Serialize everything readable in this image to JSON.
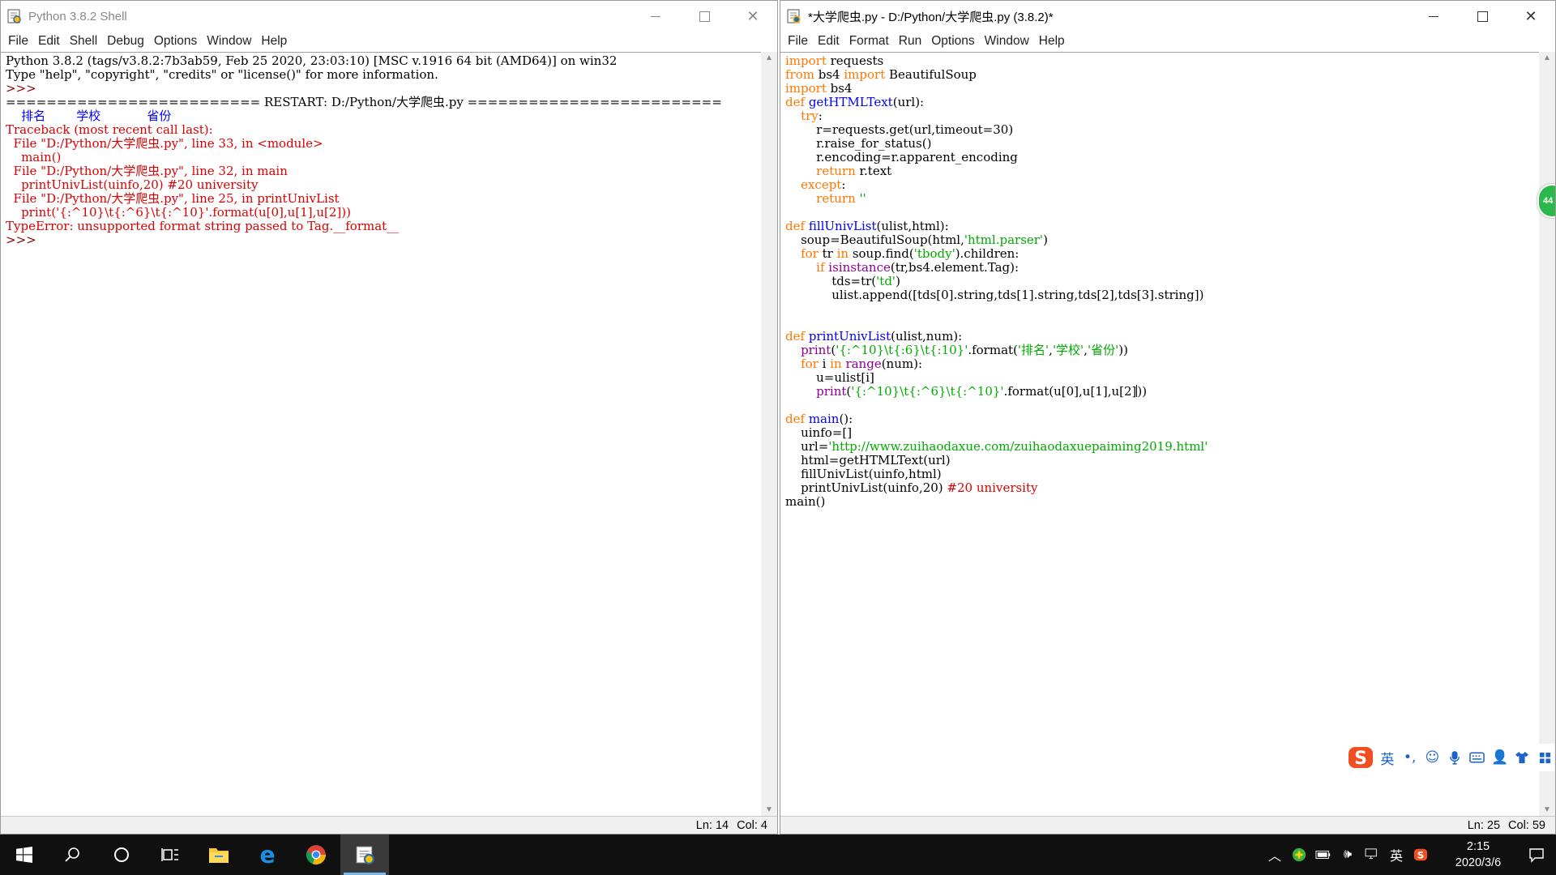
{
  "shell": {
    "title": "Python 3.8.2 Shell",
    "menu": [
      "File",
      "Edit",
      "Shell",
      "Debug",
      "Options",
      "Window",
      "Help"
    ],
    "lines": [
      {
        "text": "Python 3.8.2 (tags/v3.8.2:7b3ab59, Feb 25 2020, 23:03:10) [MSC v.1916 64 bit (AMD64)] on win32",
        "style": "plain"
      },
      {
        "text": "Type \"help\", \"copyright\", \"credits\" or \"license()\" for more information.",
        "style": "plain"
      },
      {
        "text": ">>> ",
        "style": "prompt"
      },
      {
        "text": "========================= RESTART: D:/Python/大学爬虫.py =========================",
        "style": "plain"
      },
      {
        "text": "    排名        学校            省份",
        "style": "out"
      },
      {
        "text": "Traceback (most recent call last):",
        "style": "err"
      },
      {
        "text": "  File \"D:/Python/大学爬虫.py\", line 33, in <module>",
        "style": "err"
      },
      {
        "text": "    main()",
        "style": "err"
      },
      {
        "text": "  File \"D:/Python/大学爬虫.py\", line 32, in main",
        "style": "err"
      },
      {
        "text": "    printUnivList(uinfo,20) #20 university",
        "style": "err"
      },
      {
        "text": "  File \"D:/Python/大学爬虫.py\", line 25, in printUnivList",
        "style": "err"
      },
      {
        "text": "    print('{:^10}\\t{:^6}\\t{:^10}'.format(u[0],u[1],u[2]))",
        "style": "err"
      },
      {
        "text": "TypeError: unsupported format string passed to Tag.__format__",
        "style": "err"
      },
      {
        "text": ">>> ",
        "style": "prompt"
      }
    ],
    "status": {
      "ln": "Ln: 14",
      "col": "Col: 4"
    }
  },
  "editor": {
    "title": "*大学爬虫.py - D:/Python/大学爬虫.py (3.8.2)*",
    "menu": [
      "File",
      "Edit",
      "Format",
      "Run",
      "Options",
      "Window",
      "Help"
    ],
    "code": [
      [
        [
          "kw",
          "import"
        ],
        [
          "p",
          " requests"
        ]
      ],
      [
        [
          "kw",
          "from"
        ],
        [
          "p",
          " bs4 "
        ],
        [
          "kw",
          "import"
        ],
        [
          "p",
          " BeautifulSoup"
        ]
      ],
      [
        [
          "kw",
          "import"
        ],
        [
          "p",
          " bs4"
        ]
      ],
      [
        [
          "kw",
          "def"
        ],
        [
          "p",
          " "
        ],
        [
          "fn",
          "getHTMLText"
        ],
        [
          "p",
          "(url):"
        ]
      ],
      [
        [
          "p",
          "    "
        ],
        [
          "kw",
          "try"
        ],
        [
          "p",
          ":"
        ]
      ],
      [
        [
          "p",
          "        r=requests.get(url,timeout=30)"
        ]
      ],
      [
        [
          "p",
          "        r.raise_for_status()"
        ]
      ],
      [
        [
          "p",
          "        r.encoding=r.apparent_encoding"
        ]
      ],
      [
        [
          "p",
          "        "
        ],
        [
          "kw",
          "return"
        ],
        [
          "p",
          " r.text"
        ]
      ],
      [
        [
          "p",
          "    "
        ],
        [
          "kw",
          "except"
        ],
        [
          "p",
          ":"
        ]
      ],
      [
        [
          "p",
          "        "
        ],
        [
          "kw",
          "return"
        ],
        [
          "p",
          " "
        ],
        [
          "str",
          "''"
        ]
      ],
      [
        [
          "p",
          ""
        ]
      ],
      [
        [
          "kw",
          "def"
        ],
        [
          "p",
          " "
        ],
        [
          "fn",
          "fillUnivList"
        ],
        [
          "p",
          "(ulist,html):"
        ]
      ],
      [
        [
          "p",
          "    soup=BeautifulSoup(html,"
        ],
        [
          "str",
          "'html.parser'"
        ],
        [
          "p",
          ")"
        ]
      ],
      [
        [
          "p",
          "    "
        ],
        [
          "kw",
          "for"
        ],
        [
          "p",
          " tr "
        ],
        [
          "kw",
          "in"
        ],
        [
          "p",
          " soup.find("
        ],
        [
          "str",
          "'tbody'"
        ],
        [
          "p",
          ").children:"
        ]
      ],
      [
        [
          "p",
          "        "
        ],
        [
          "kw",
          "if"
        ],
        [
          "p",
          " "
        ],
        [
          "bi",
          "isinstance"
        ],
        [
          "p",
          "(tr,bs4.element.Tag):"
        ]
      ],
      [
        [
          "p",
          "            tds=tr("
        ],
        [
          "str",
          "'td'"
        ],
        [
          "p",
          ")"
        ]
      ],
      [
        [
          "p",
          "            ulist.append([tds[0].string,tds[1].string,tds[2],tds[3].string])"
        ]
      ],
      [
        [
          "p",
          ""
        ]
      ],
      [
        [
          "p",
          ""
        ]
      ],
      [
        [
          "kw",
          "def"
        ],
        [
          "p",
          " "
        ],
        [
          "fn",
          "printUnivList"
        ],
        [
          "p",
          "(ulist,num):"
        ]
      ],
      [
        [
          "p",
          "    "
        ],
        [
          "bi",
          "print"
        ],
        [
          "p",
          "("
        ],
        [
          "str",
          "'{:^10}\\t{:6}\\t{:10}'"
        ],
        [
          "p",
          ".format("
        ],
        [
          "str",
          "'排名'"
        ],
        [
          "p",
          ","
        ],
        [
          "str",
          "'学校'"
        ],
        [
          "p",
          ","
        ],
        [
          "str",
          "'省份'"
        ],
        [
          "p",
          "))"
        ]
      ],
      [
        [
          "p",
          "    "
        ],
        [
          "kw",
          "for"
        ],
        [
          "p",
          " i "
        ],
        [
          "kw",
          "in"
        ],
        [
          "p",
          " "
        ],
        [
          "bi",
          "range"
        ],
        [
          "p",
          "(num):"
        ]
      ],
      [
        [
          "p",
          "        u=ulist[i]"
        ]
      ],
      [
        [
          "p",
          "        "
        ],
        [
          "bi",
          "print"
        ],
        [
          "p",
          "("
        ],
        [
          "str",
          "'{:^10}\\t{:^6}\\t{:^10}'"
        ],
        [
          "p",
          ".format(u[0],u[1],u[2]"
        ],
        [
          "caret",
          ""
        ],
        [
          "p",
          "))"
        ]
      ],
      [
        [
          "p",
          ""
        ]
      ],
      [
        [
          "kw",
          "def"
        ],
        [
          "p",
          " "
        ],
        [
          "fn",
          "main"
        ],
        [
          "p",
          "():"
        ]
      ],
      [
        [
          "p",
          "    uinfo=[]"
        ]
      ],
      [
        [
          "p",
          "    url="
        ],
        [
          "str",
          "'http://www.zuihaodaxue.com/zuihaodaxuepaiming2019.html'"
        ]
      ],
      [
        [
          "p",
          "    html=getHTMLText(url)"
        ]
      ],
      [
        [
          "p",
          "    fillUnivList(uinfo,html)"
        ]
      ],
      [
        [
          "p",
          "    printUnivList(uinfo,20) "
        ],
        [
          "cm",
          "#20 university"
        ]
      ],
      [
        [
          "p",
          "main()"
        ]
      ]
    ],
    "status": {
      "ln": "Ln: 25",
      "col": "Col: 59"
    }
  },
  "ime": {
    "lang": "英",
    "punct": "•,",
    "badge": "44"
  },
  "taskbar": {
    "tray_lang": "英",
    "time": "2:15",
    "date": "2020/3/6"
  }
}
